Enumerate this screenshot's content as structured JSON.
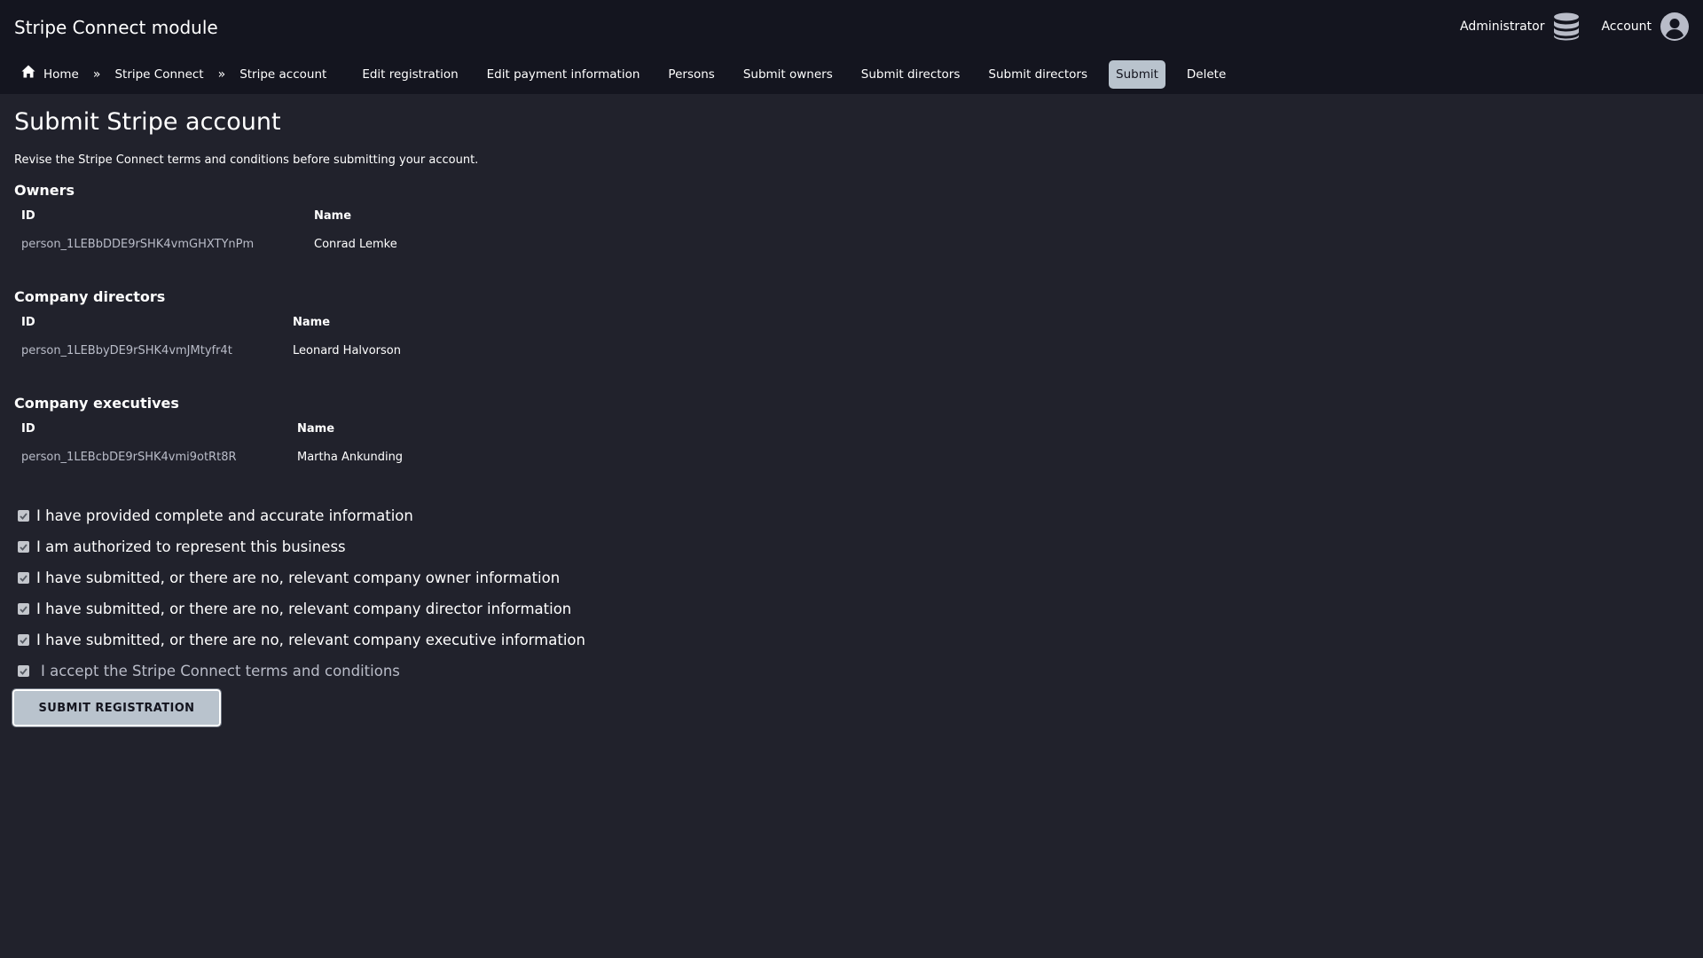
{
  "header": {
    "title": "Stripe Connect module",
    "administrator_label": "Administrator",
    "account_label": "Account"
  },
  "nav": {
    "home": "Home",
    "separator": "»",
    "stripe_connect": "Stripe Connect",
    "links": [
      {
        "label": "Stripe account",
        "active": false
      },
      {
        "label": "Edit registration",
        "active": false
      },
      {
        "label": "Edit payment information",
        "active": false
      },
      {
        "label": "Persons",
        "active": false
      },
      {
        "label": "Submit owners",
        "active": false
      },
      {
        "label": "Submit directors",
        "active": false
      },
      {
        "label": "Submit directors",
        "active": false
      },
      {
        "label": "Submit",
        "active": true
      },
      {
        "label": "Delete",
        "active": false
      }
    ]
  },
  "page": {
    "title": "Submit Stripe account",
    "description": "Revise the Stripe Connect terms and conditions before submitting your account."
  },
  "sections": [
    {
      "title": "Owners",
      "columns": [
        "ID",
        "Name"
      ],
      "rows": [
        [
          "person_1LEBbDDE9rSHK4vmGHXTYnPm",
          "Conrad Lemke"
        ]
      ]
    },
    {
      "title": "Company directors",
      "columns": [
        "ID",
        "Name"
      ],
      "rows": [
        [
          "person_1LEBbyDE9rSHK4vmJMtyfr4t",
          "Leonard Halvorson"
        ]
      ]
    },
    {
      "title": "Company executives",
      "columns": [
        "ID",
        "Name"
      ],
      "rows": [
        [
          "person_1LEBcbDE9rSHK4vmi9otRt8R",
          "Martha Ankunding"
        ]
      ]
    }
  ],
  "checks": [
    {
      "label": "I have provided complete and accurate information",
      "checked": true
    },
    {
      "label": "I am authorized to represent this business",
      "checked": true
    },
    {
      "label": "I have submitted, or there are no, relevant company owner information",
      "checked": true
    },
    {
      "label": "I have submitted, or there are no, relevant company director information",
      "checked": true
    },
    {
      "label": "I have submitted, or there are no, relevant company executive information",
      "checked": true
    },
    {
      "label": "I accept the Stripe Connect terms and conditions",
      "checked": true
    }
  ],
  "submit_button": "SUBMIT REGISTRATION",
  "colors": {
    "background": "#21222c",
    "header": "#14151f",
    "accent": "#b9c3cd"
  }
}
